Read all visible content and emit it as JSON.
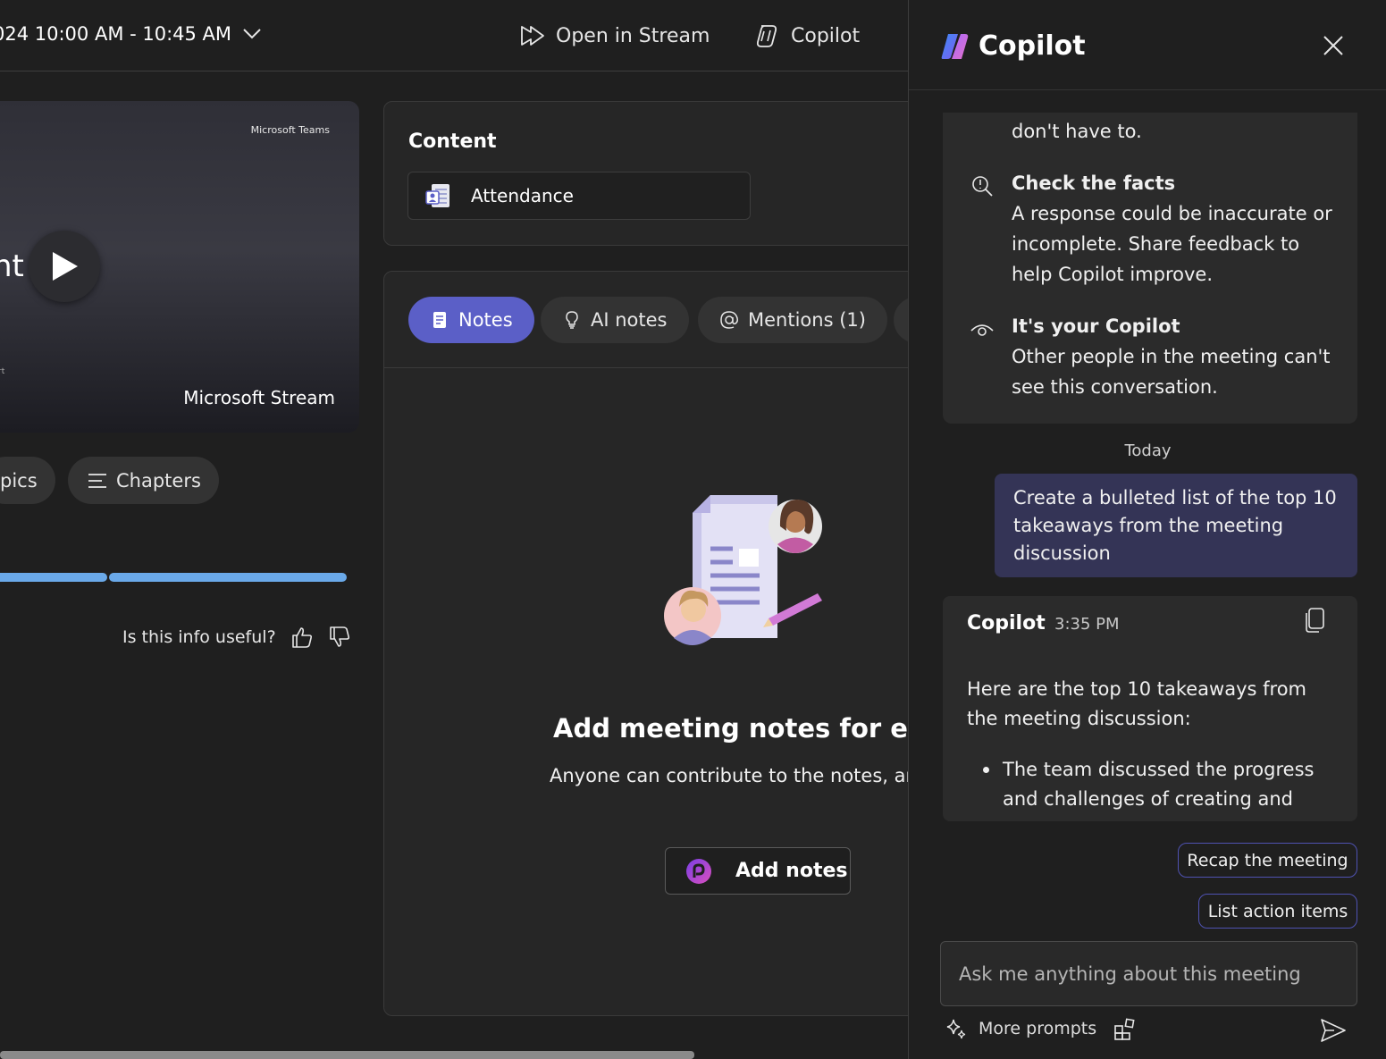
{
  "topbar": {
    "date_range": "024 10:00 AM - 10:45 AM",
    "open_in_stream": "Open in Stream",
    "copilot": "Copilot"
  },
  "video": {
    "brand_small": "Microsoft Teams",
    "cut_title": "nt",
    "tiny_text": "rt",
    "stream_label": "Microsoft Stream"
  },
  "left_tabs": {
    "topics": "pics",
    "chapters": "Chapters"
  },
  "feedback": {
    "question": "Is this info useful?"
  },
  "content_card": {
    "title": "Content",
    "attendance": "Attendance"
  },
  "notes_tabs": [
    {
      "label": "Notes"
    },
    {
      "label": "AI notes"
    },
    {
      "label": "Mentions (1)"
    }
  ],
  "notes_empty": {
    "title": "Add meeting notes for every",
    "subtitle": "Anyone can contribute to the notes, an",
    "button": "Add notes"
  },
  "copilot_panel": {
    "title": "Copilot",
    "tip_cut": "don't have to.",
    "tip1_title": "Check the facts",
    "tip1_body": "A response could be inaccurate or incomplete. Share feedback to help Copilot improve.",
    "tip2_title": "It's your Copilot",
    "tip2_body": "Other people in the meeting can't see this conversation.",
    "day_label": "Today",
    "user_message": "Create a bulleted list of the top 10 takeaways from the meeting discussion",
    "response": {
      "author": "Copilot",
      "time": "3:35 PM",
      "intro": "Here are the top 10 takeaways from the meeting discussion:",
      "bullet1": "The team discussed the progress and challenges of creating and"
    },
    "suggestions": [
      "Recap the meeting",
      "List action items"
    ],
    "input_placeholder": "Ask me anything about this meeting",
    "more_prompts": "More prompts"
  },
  "colors": {
    "accent": "#5b5fc7",
    "user_bubble": "#343456",
    "progress": "#6aa9e9"
  }
}
